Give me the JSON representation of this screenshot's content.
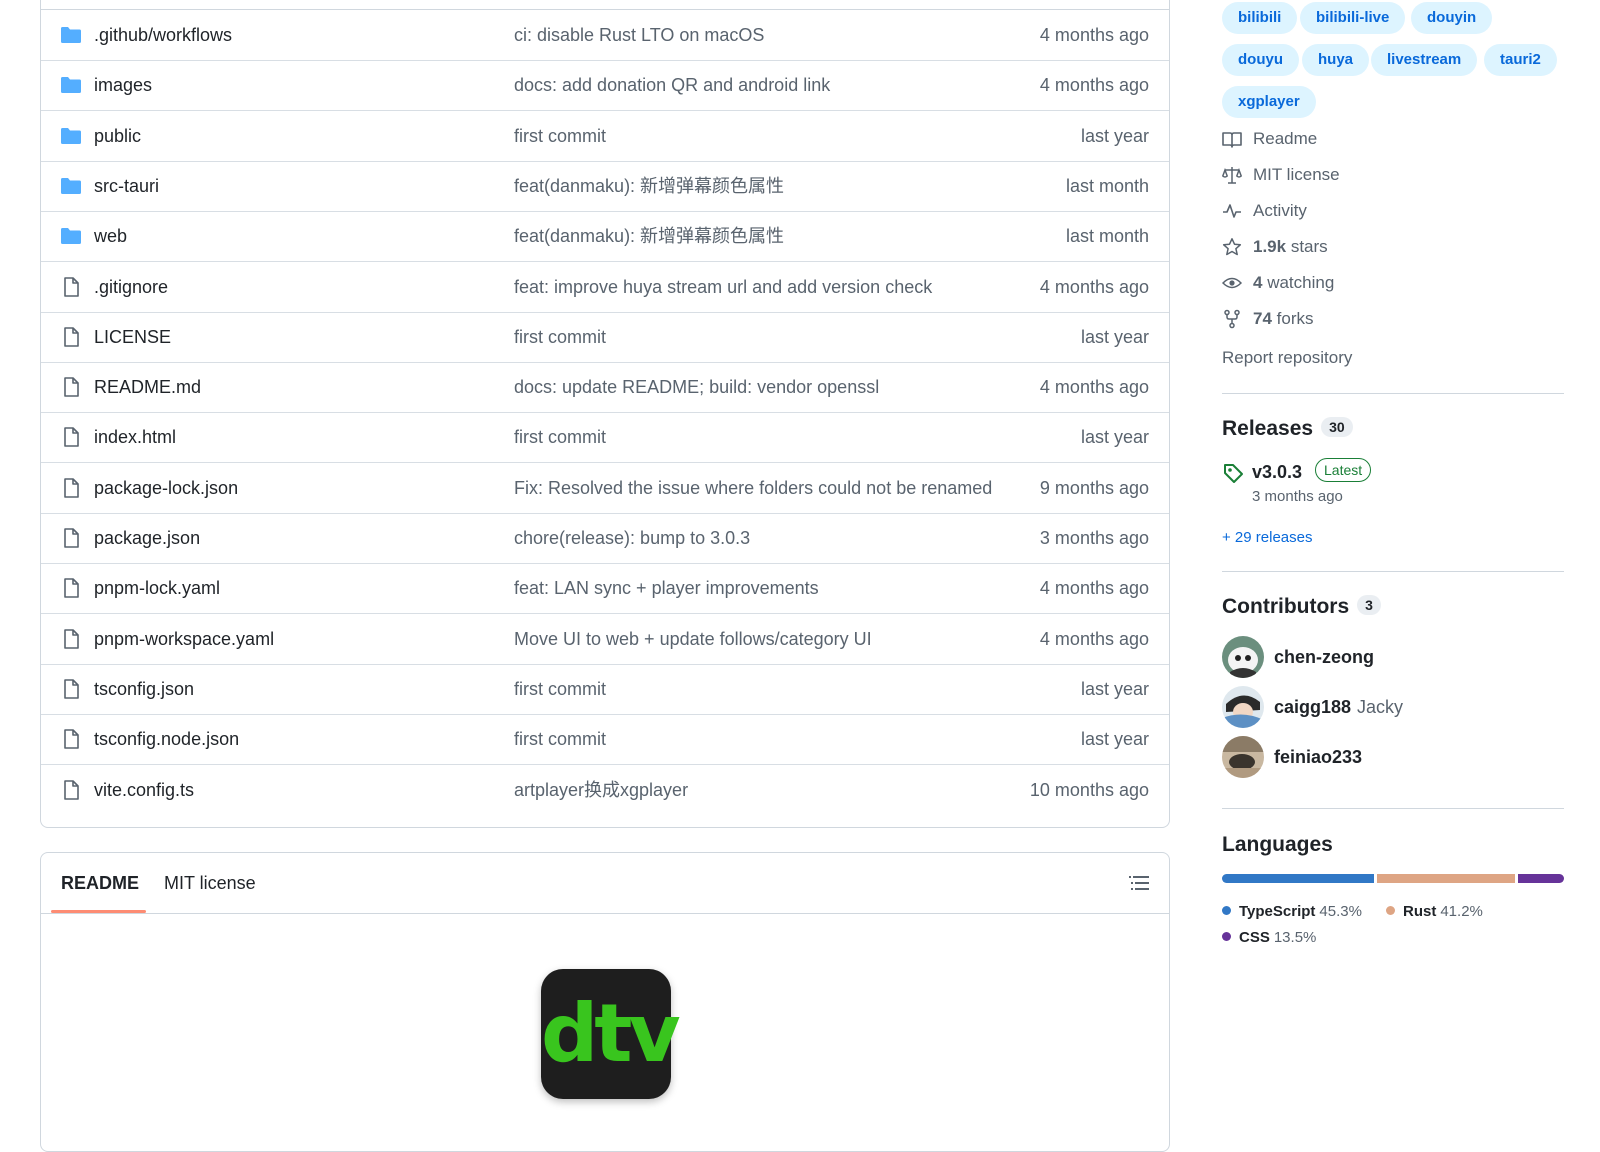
{
  "files": [
    {
      "type": "folder",
      "name": ".github/workflows",
      "message": "ci: disable Rust LTO on macOS",
      "date": "4 months ago"
    },
    {
      "type": "folder",
      "name": "images",
      "message": "docs: add donation QR and android link",
      "date": "4 months ago"
    },
    {
      "type": "folder",
      "name": "public",
      "message": "first commit",
      "date": "last year"
    },
    {
      "type": "folder",
      "name": "src-tauri",
      "message": "feat(danmaku): 新增弹幕颜色属性",
      "date": "last month"
    },
    {
      "type": "folder",
      "name": "web",
      "message": "feat(danmaku): 新增弹幕颜色属性",
      "date": "last month"
    },
    {
      "type": "file",
      "name": ".gitignore",
      "message": "feat: improve huya stream url and add version check",
      "date": "4 months ago"
    },
    {
      "type": "file",
      "name": "LICENSE",
      "message": "first commit",
      "date": "last year"
    },
    {
      "type": "file",
      "name": "README.md",
      "message": "docs: update README; build: vendor openssl",
      "date": "4 months ago"
    },
    {
      "type": "file",
      "name": "index.html",
      "message": "first commit",
      "date": "last year"
    },
    {
      "type": "file",
      "name": "package-lock.json",
      "message": "Fix: Resolved the issue where folders could not be renamed",
      "date": "9 months ago"
    },
    {
      "type": "file",
      "name": "package.json",
      "message": "chore(release): bump to 3.0.3",
      "date": "3 months ago"
    },
    {
      "type": "file",
      "name": "pnpm-lock.yaml",
      "message": "feat: LAN sync + player improvements",
      "date": "4 months ago"
    },
    {
      "type": "file",
      "name": "pnpm-workspace.yaml",
      "message": "Move UI to web + update follows/category UI",
      "date": "4 months ago"
    },
    {
      "type": "file",
      "name": "tsconfig.json",
      "message": "first commit",
      "date": "last year"
    },
    {
      "type": "file",
      "name": "tsconfig.node.json",
      "message": "first commit",
      "date": "last year"
    },
    {
      "type": "file",
      "name": "vite.config.ts",
      "message": "artplayer换成xgplayer",
      "date": "10 months ago"
    }
  ],
  "readme": {
    "tabs": [
      "README",
      "MIT license"
    ],
    "logo_text": "dtv"
  },
  "sidebar": {
    "topics": [
      "bilibili",
      "bilibili-live",
      "douyin",
      "douyu",
      "huya",
      "livestream",
      "tauri2",
      "xgplayer"
    ],
    "meta": [
      {
        "icon": "book-icon",
        "text": "Readme"
      },
      {
        "icon": "law-icon",
        "text": "MIT license"
      },
      {
        "icon": "pulse-icon",
        "text": "Activity"
      },
      {
        "icon": "star-icon",
        "strong": "1.9k",
        "text": "stars"
      },
      {
        "icon": "eye-icon",
        "strong": "4",
        "text": "watching"
      },
      {
        "icon": "fork-icon",
        "strong": "74",
        "text": "forks"
      }
    ],
    "report": "Report repository",
    "releases": {
      "title": "Releases",
      "count": "30",
      "latest_version": "v3.0.3",
      "latest_badge": "Latest",
      "latest_date": "3 months ago",
      "more": "+ 29 releases"
    },
    "contributors": {
      "title": "Contributors",
      "count": "3",
      "people": [
        {
          "login": "chen-zeong",
          "name": ""
        },
        {
          "login": "caigg188",
          "name": "Jacky"
        },
        {
          "login": "feiniao233",
          "name": ""
        }
      ]
    },
    "languages": {
      "title": "Languages",
      "items": [
        {
          "name": "TypeScript",
          "pct": "45.3%",
          "value": 45.3,
          "color": "#3178c6"
        },
        {
          "name": "Rust",
          "pct": "41.2%",
          "value": 41.2,
          "color": "#dea584"
        },
        {
          "name": "CSS",
          "pct": "13.5%",
          "value": 13.5,
          "color": "#663399"
        }
      ]
    }
  }
}
